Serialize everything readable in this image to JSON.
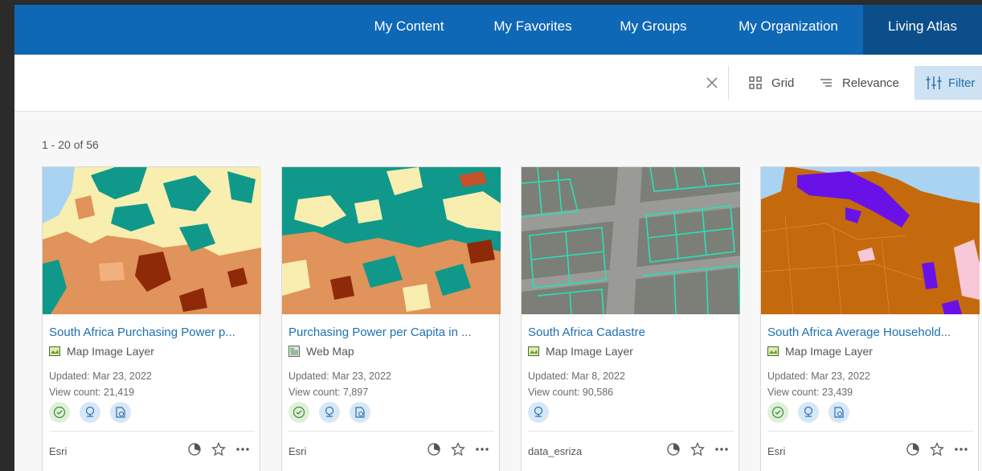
{
  "nav": {
    "tabs": [
      {
        "label": "My Content"
      },
      {
        "label": "My Favorites"
      },
      {
        "label": "My Groups"
      },
      {
        "label": "My Organization"
      },
      {
        "label": "Living Atlas"
      }
    ],
    "active_tab": "Living Atlas"
  },
  "toolbar": {
    "grid_label": "Grid",
    "sort_label": "Relevance",
    "filter_label": "Filter"
  },
  "results": {
    "count_text": "1 - 20 of 56"
  },
  "cards": [
    {
      "title": "South Africa Purchasing Power p...",
      "type": "Map Image Layer",
      "type_icon": "map-image-layer-icon",
      "updated": "Updated: Mar 23, 2022",
      "views": "View count: 21,419",
      "badges": [
        "authoritative-icon",
        "living-atlas-icon",
        "subscriber-content-icon"
      ],
      "owner": "Esri"
    },
    {
      "title": "Purchasing Power per Capita in ...",
      "type": "Web Map",
      "type_icon": "web-map-icon",
      "updated": "Updated: Mar 23, 2022",
      "views": "View count: 7,897",
      "badges": [
        "authoritative-icon",
        "living-atlas-icon",
        "subscriber-content-icon"
      ],
      "owner": "Esri"
    },
    {
      "title": "South Africa Cadastre",
      "type": "Map Image Layer",
      "type_icon": "map-image-layer-icon",
      "updated": "Updated: Mar 8, 2022",
      "views": "View count: 90,586",
      "badges": [
        "living-atlas-icon"
      ],
      "owner": "data_esriza"
    },
    {
      "title": "South Africa Average Household...",
      "type": "Map Image Layer",
      "type_icon": "map-image-layer-icon",
      "updated": "Updated: Mar 23, 2022",
      "views": "View count: 23,439",
      "badges": [
        "authoritative-icon",
        "living-atlas-icon",
        "subscriber-content-icon"
      ],
      "owner": "Esri"
    }
  ],
  "colors": {
    "nav_bg": "#0f68b5",
    "nav_active": "#0c4e8a",
    "link": "#1f6fb4",
    "teal": "#10998a",
    "orange": "#e0935a",
    "pale_yellow": "#f7eeb0",
    "dark_red": "#8f2a08",
    "water": "#a9d3f2",
    "purple": "#6a11e8",
    "brown": "#c56a0c"
  }
}
